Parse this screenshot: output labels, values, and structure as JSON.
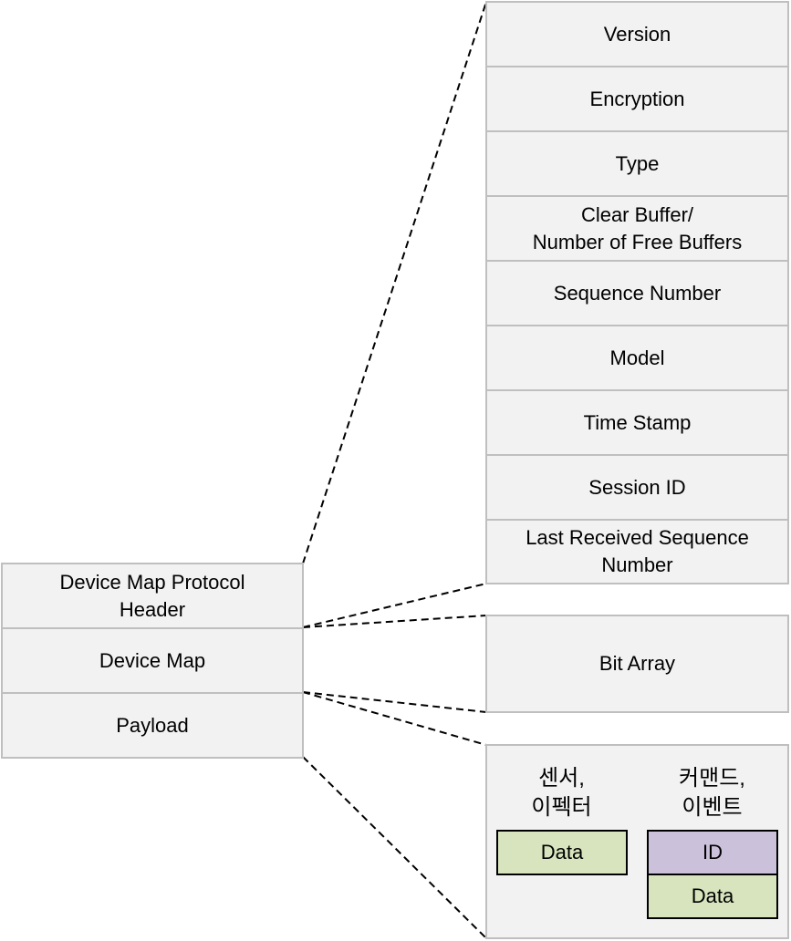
{
  "header_fields": [
    "Version",
    "Encryption",
    "Type",
    "Clear Buffer/\nNumber of Free Buffers",
    "Sequence Number",
    "Model",
    "Time Stamp",
    "Session ID",
    "Last Received Sequence\nNumber"
  ],
  "packet": {
    "header": "Device Map Protocol\nHeader",
    "device_map": "Device Map",
    "payload": "Payload"
  },
  "device_map_detail": "Bit Array",
  "payload_detail": {
    "sensor_label": "센서,\n이펙터",
    "sensor_data": "Data",
    "command_label": "커맨드,\n이벤트",
    "command_id": "ID",
    "command_data": "Data"
  },
  "colors": {
    "box_fill": "#f2f2f2",
    "box_border": "#bfbfbf",
    "data_fill": "#d7e4bd",
    "id_fill": "#ccc1da"
  }
}
